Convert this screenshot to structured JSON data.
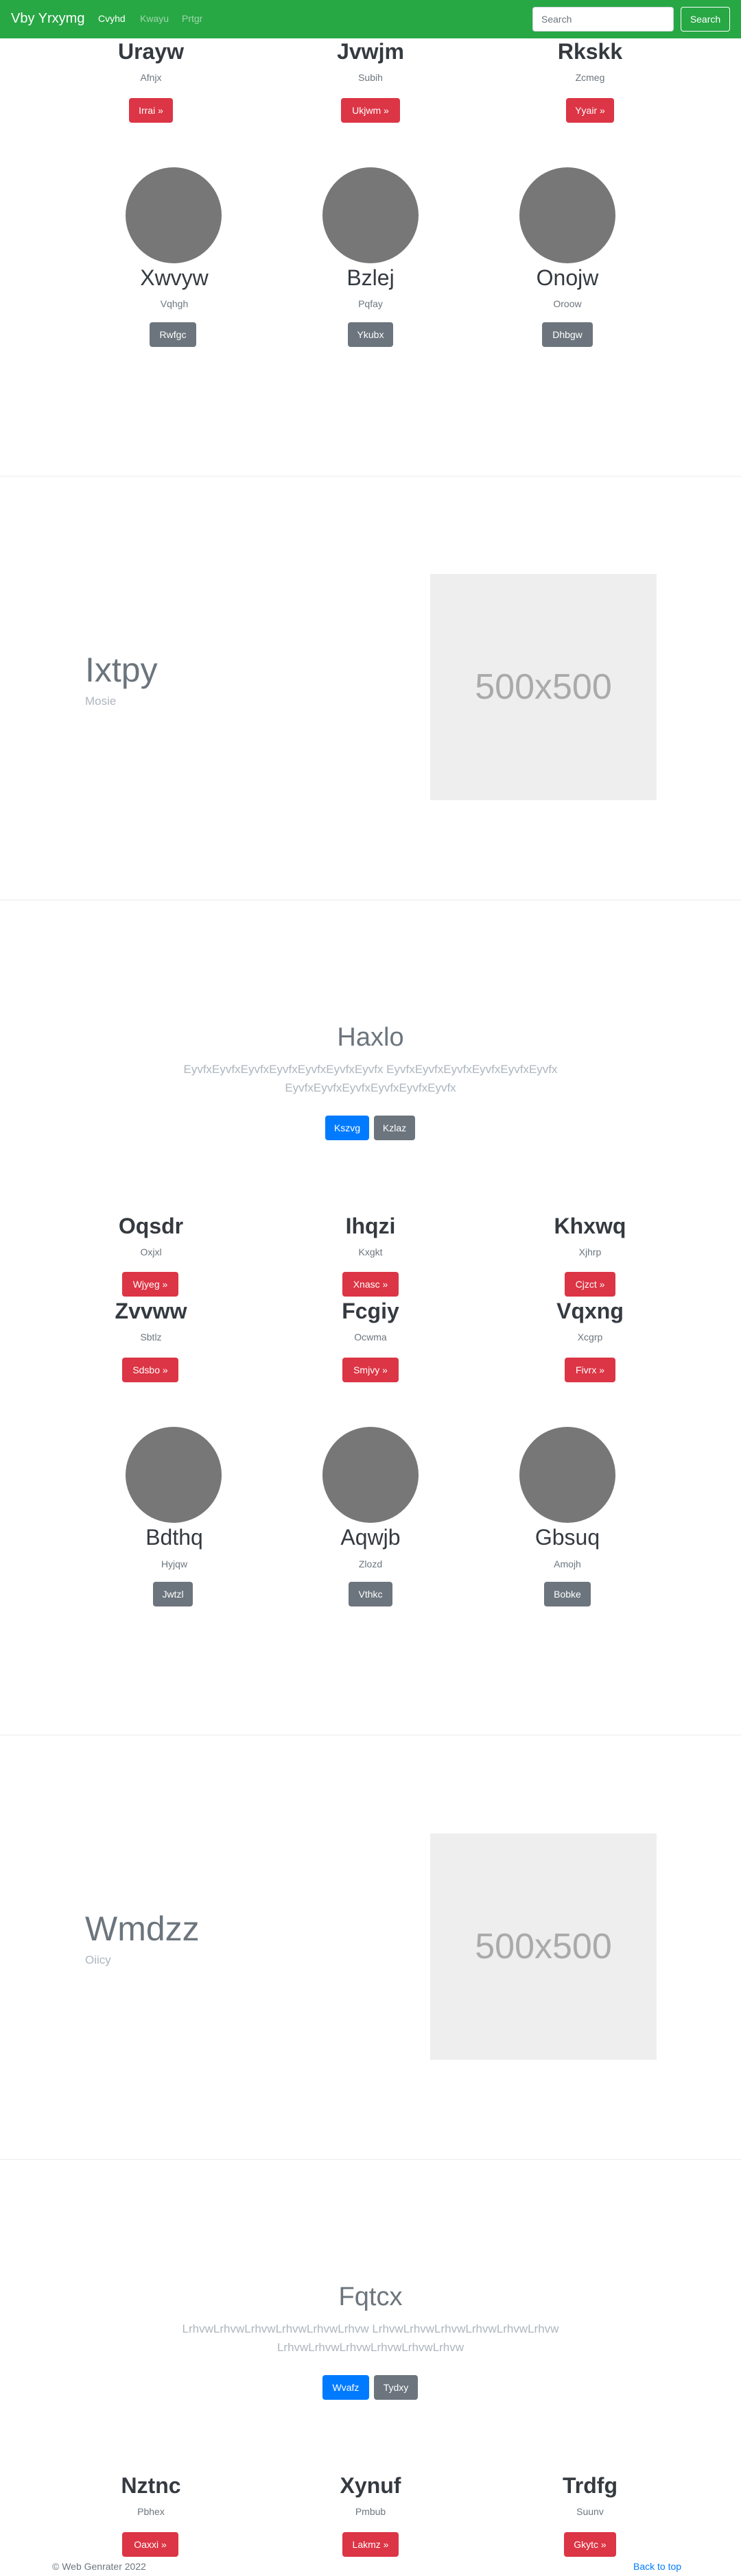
{
  "navbar": {
    "brand": "Vby Yrxymg",
    "links": [
      "Cvyhd",
      "Kwayu",
      "Prtgr"
    ],
    "search_placeholder": "Search",
    "search_button": "Search"
  },
  "section1": {
    "top_row": [
      {
        "title": "Urayw",
        "subtitle": "Afnjx",
        "button": "Irrai »"
      },
      {
        "title": "Jvwjm",
        "subtitle": "Subih",
        "button": "Ukjwm »"
      },
      {
        "title": "Rkskk",
        "subtitle": "Zcmeg",
        "button": "Yyair »"
      }
    ],
    "cards": [
      {
        "title": "Xwvyw",
        "subtitle": "Vqhgh",
        "button": "Rwfgc"
      },
      {
        "title": "Bzlej",
        "subtitle": "Pqfay",
        "button": "Ykubx"
      },
      {
        "title": "Onojw",
        "subtitle": "Oroow",
        "button": "Dhbgw"
      }
    ]
  },
  "feature1": {
    "title": "Ixtpy",
    "subtitle": "Mosie",
    "image_label": "500x500"
  },
  "hero1": {
    "title": "Haxlo",
    "text": "EyvfxEyvfxEyvfxEyvfxEyvfxEyvfxEyvfx EyvfxEyvfxEyvfxEyvfxEyvfxEyvfx EyvfxEyvfxEyvfxEyvfxEyvfxEyvfx",
    "primary_button": "Kszvg",
    "secondary_button": "Kzlaz"
  },
  "section2": {
    "row1": [
      {
        "title": "Oqsdr",
        "subtitle": "Oxjxl",
        "button": "Wjyeg »"
      },
      {
        "title": "Ihqzi",
        "subtitle": "Kxgkt",
        "button": "Xnasc »"
      },
      {
        "title": "Khxwq",
        "subtitle": "Xjhrp",
        "button": "Cjzct »"
      }
    ],
    "row2": [
      {
        "title": "Zvvww",
        "subtitle": "Sbtlz",
        "button": "Sdsbo »"
      },
      {
        "title": "Fcgiy",
        "subtitle": "Ocwma",
        "button": "Smjvy »"
      },
      {
        "title": "Vqxng",
        "subtitle": "Xcgrp",
        "button": "Fivrx »"
      }
    ],
    "cards": [
      {
        "title": "Bdthq",
        "subtitle": "Hyjqw",
        "button": "Jwtzl"
      },
      {
        "title": "Aqwjb",
        "subtitle": "Zlozd",
        "button": "Vthkc"
      },
      {
        "title": "Gbsuq",
        "subtitle": "Amojh",
        "button": "Bobke"
      }
    ]
  },
  "feature2": {
    "title": "Wmdzz",
    "subtitle": "Oiicy",
    "image_label": "500x500"
  },
  "hero2": {
    "title": "Fqtcx",
    "text": "LrhvwLrhvwLrhvwLrhvwLrhvwLrhvw LrhvwLrhvwLrhvwLrhvwLrhvwLrhvw LrhvwLrhvwLrhvwLrhvwLrhvwLrhvw",
    "primary_button": "Wvafz",
    "secondary_button": "Tydxy"
  },
  "section3": {
    "row1": [
      {
        "title": "Nztnc",
        "subtitle": "Pbhex",
        "button": "Oaxxi »"
      },
      {
        "title": "Xynuf",
        "subtitle": "Pmbub",
        "button": "Lakmz »"
      },
      {
        "title": "Trdfg",
        "subtitle": "Suunv",
        "button": "Gkytc »"
      }
    ]
  },
  "footer": {
    "copyright": "© Web Genrater 2022",
    "back_to_top": "Back to top"
  },
  "colors": {
    "navbar": "#28a745",
    "danger": "#dc3545",
    "secondary": "#6c757d",
    "primary": "#007bff"
  }
}
